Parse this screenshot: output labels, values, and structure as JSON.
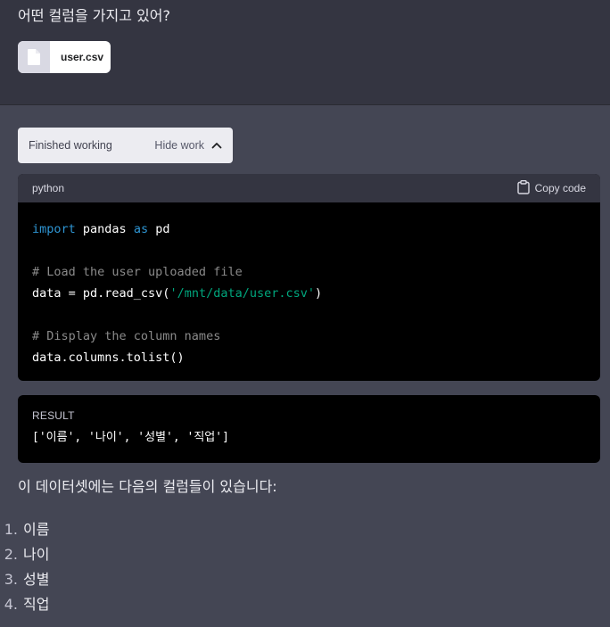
{
  "user_message": {
    "text": "어떤 컬럼을 가지고 있어?",
    "attachment": {
      "filename": "user.csv",
      "icon": "file-icon"
    }
  },
  "work_panel": {
    "status": "Finished working",
    "toggle_label": "Hide work",
    "toggle_icon": "chevron-up-icon"
  },
  "code_block": {
    "language": "python",
    "copy_label": "Copy code",
    "copy_icon": "clipboard-icon",
    "lines": {
      "l1_kw1": "import",
      "l1_txt1": " pandas ",
      "l1_kw2": "as",
      "l1_txt2": " pd",
      "l3_comment": "# Load the user uploaded file",
      "l4_txt": "data = pd.read_csv(",
      "l4_str": "'/mnt/data/user.csv'",
      "l4_end": ")",
      "l6_comment": "# Display the column names",
      "l7_txt": "data.columns.tolist()"
    }
  },
  "result": {
    "label": "RESULT",
    "value": "['이름', '나이', '성별', '직업']"
  },
  "answer": {
    "intro": "이 데이터셋에는 다음의 컬럼들이 있습니다:",
    "columns": [
      {
        "num": "1.",
        "name": "이름"
      },
      {
        "num": "2.",
        "name": "나이"
      },
      {
        "num": "3.",
        "name": "성별"
      },
      {
        "num": "4.",
        "name": "직업"
      }
    ]
  },
  "colors": {
    "background": "#444654",
    "user_bg": "#343541",
    "code_bg": "#000000",
    "keyword": "#2e95d3",
    "string": "#00a67d",
    "comment": "#8a8a8a"
  }
}
